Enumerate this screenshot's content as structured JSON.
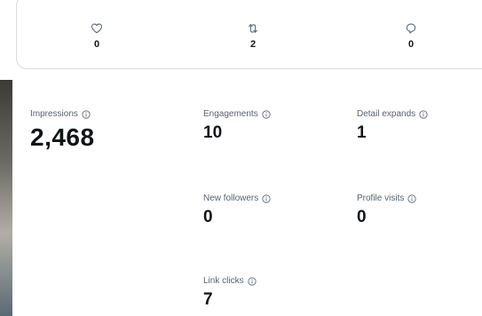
{
  "engagement_summary": {
    "likes": {
      "icon": "heart-icon",
      "count": "0"
    },
    "reposts": {
      "icon": "repost-icon",
      "count": "2"
    },
    "replies": {
      "icon": "reply-icon",
      "count": "0"
    }
  },
  "metrics": {
    "impressions": {
      "label": "Impressions",
      "value": "2,468"
    },
    "engagements": {
      "label": "Engagements",
      "value": "10"
    },
    "detail_expands": {
      "label": "Detail expands",
      "value": "1"
    },
    "new_followers": {
      "label": "New followers",
      "value": "0"
    },
    "profile_visits": {
      "label": "Profile visits",
      "value": "0"
    },
    "link_clicks": {
      "label": "Link clicks",
      "value": "7"
    }
  },
  "colors": {
    "text_primary": "#0f1419",
    "text_secondary": "#536471",
    "border": "#d7dce0"
  }
}
